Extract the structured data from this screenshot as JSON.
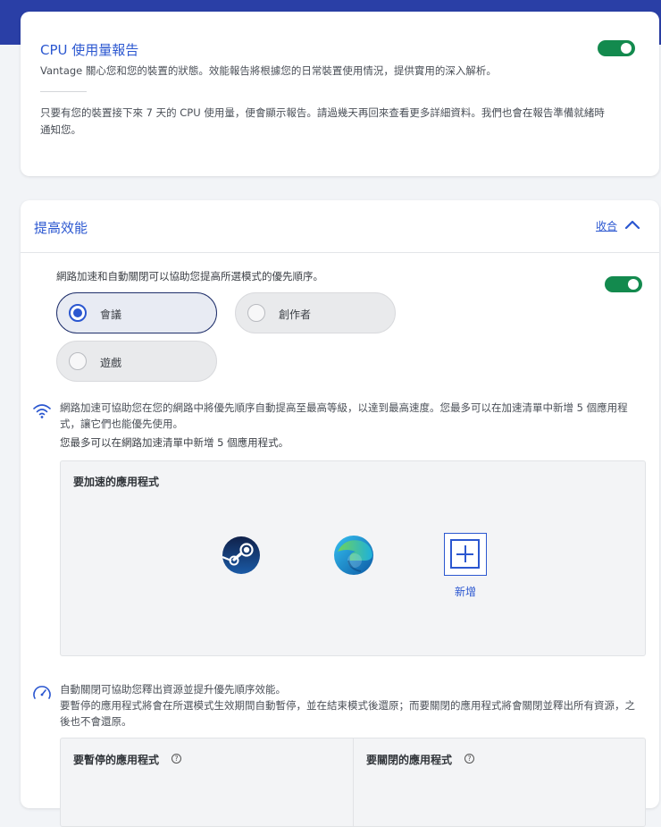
{
  "cpu_report": {
    "title": "CPU 使用量報告",
    "description": "Vantage 關心您和您的裝置的狀態。效能報告將根據您的日常裝置使用情況，提供實用的深入解析。",
    "note": "只要有您的裝置接下來 7 天的 CPU 使用量，便會顯示報告。請過幾天再回來查看更多詳細資料。我們也會在報告準備就緒時通知您。",
    "toggle_on": true
  },
  "performance": {
    "title": "提高效能",
    "collapse_label": "收合",
    "mode_description": "網路加速和自動關閉可以協助您提高所選模式的優先順序。",
    "toggle_on": true,
    "modes": [
      {
        "label": "會議",
        "selected": true
      },
      {
        "label": "創作者",
        "selected": false
      },
      {
        "label": "遊戲",
        "selected": false
      }
    ],
    "network_boost": {
      "description": "網路加速可協助您在您的網路中將優先順序自動提高至最高等級，以達到最高速度。您最多可以在加速清單中新增 5 個應用程式，讓它們也能優先使用。",
      "limit_note": "您最多可以在網路加速清單中新增 5 個應用程式。",
      "panel_title": "要加速的應用程式",
      "apps": [
        "steam-icon",
        "edge-icon"
      ],
      "add_label": "新增"
    },
    "auto_close": {
      "description_line1": "自動關閉可協助您釋出資源並提升優先順序效能。",
      "description_line2": "要暫停的應用程式將會在所選模式生效期間自動暫停，並在結束模式後還原；而要關閉的應用程式將會關閉並釋出所有資源，之後也不會還原。",
      "pause_title": "要暫停的應用程式",
      "close_title": "要關閉的應用程式",
      "help_glyph": "?"
    }
  },
  "colors": {
    "accent": "#2b57d0",
    "toggle_on": "#138a4e",
    "top_band": "#2a3fa6",
    "selected_border": "#1f2f6b"
  }
}
